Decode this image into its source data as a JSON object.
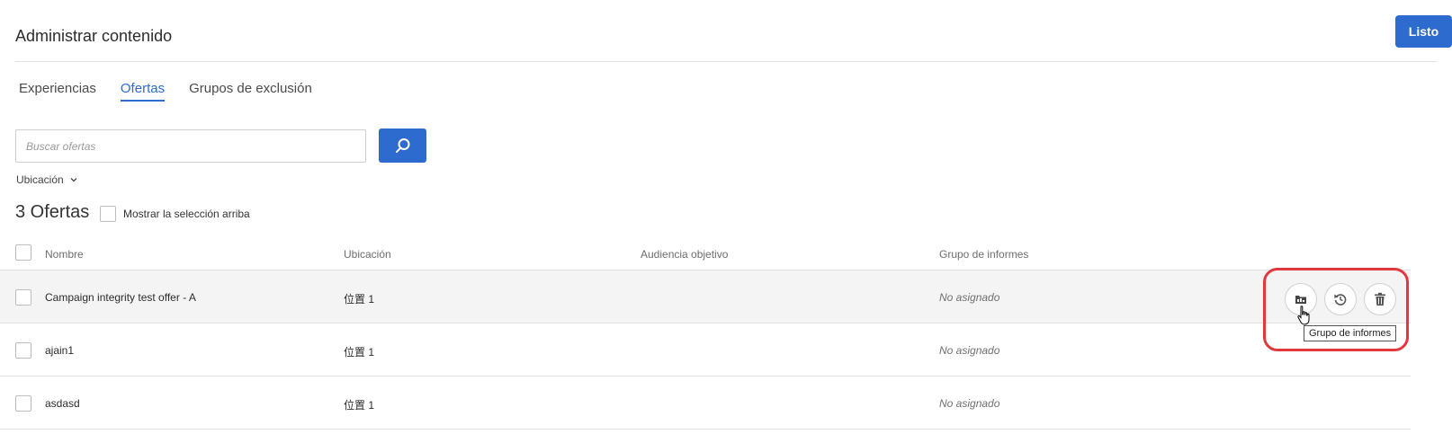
{
  "header": {
    "title": "Administrar contenido",
    "done_label": "Listo"
  },
  "tabs": [
    {
      "label": "Experiencias",
      "active": false
    },
    {
      "label": "Ofertas",
      "active": true
    },
    {
      "label": "Grupos de exclusión",
      "active": false
    }
  ],
  "search": {
    "placeholder": "Buscar ofertas",
    "value": ""
  },
  "filter": {
    "location_label": "Ubicación"
  },
  "list": {
    "count_label": "3 Ofertas",
    "show_selection_label": "Mostrar la selección arriba"
  },
  "table": {
    "columns": [
      "Nombre",
      "Ubicación",
      "Audiencia objetivo",
      "Grupo de informes"
    ],
    "rows": [
      {
        "name": "Campaign integrity test offer - A",
        "location": "位置 1",
        "audience": "",
        "report_group": "No asignado"
      },
      {
        "name": "ajain1",
        "location": "位置 1",
        "audience": "",
        "report_group": "No asignado"
      },
      {
        "name": "asdasd",
        "location": "位置 1",
        "audience": "",
        "report_group": "No asignado"
      }
    ]
  },
  "row_actions": {
    "icons": [
      "report-group-icon",
      "reset-icon",
      "trash-icon"
    ]
  },
  "tooltip": {
    "text": "Grupo de informes"
  },
  "colors": {
    "accent": "#2d6bcf",
    "highlight": "#e0383e"
  }
}
